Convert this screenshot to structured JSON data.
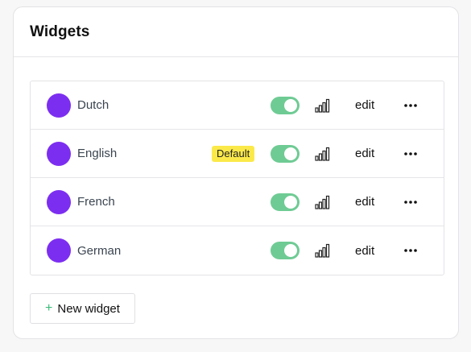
{
  "card": {
    "title": "Widgets"
  },
  "colors": {
    "avatar": "#7c2ef0",
    "toggle_on": "#6fcb94",
    "badge": "#fbe94a",
    "plus": "#3dbb7a"
  },
  "widgets": [
    {
      "name": "Dutch",
      "badge": "",
      "enabled": true,
      "edit_label": "edit"
    },
    {
      "name": "English",
      "badge": "Default",
      "enabled": true,
      "edit_label": "edit"
    },
    {
      "name": "French",
      "badge": "",
      "enabled": true,
      "edit_label": "edit"
    },
    {
      "name": "German",
      "badge": "",
      "enabled": true,
      "edit_label": "edit"
    }
  ],
  "icons": {
    "stats": "bar-chart-icon",
    "more": "more-horizontal-icon",
    "add": "plus-icon"
  },
  "new_button": {
    "label": "New widget"
  }
}
